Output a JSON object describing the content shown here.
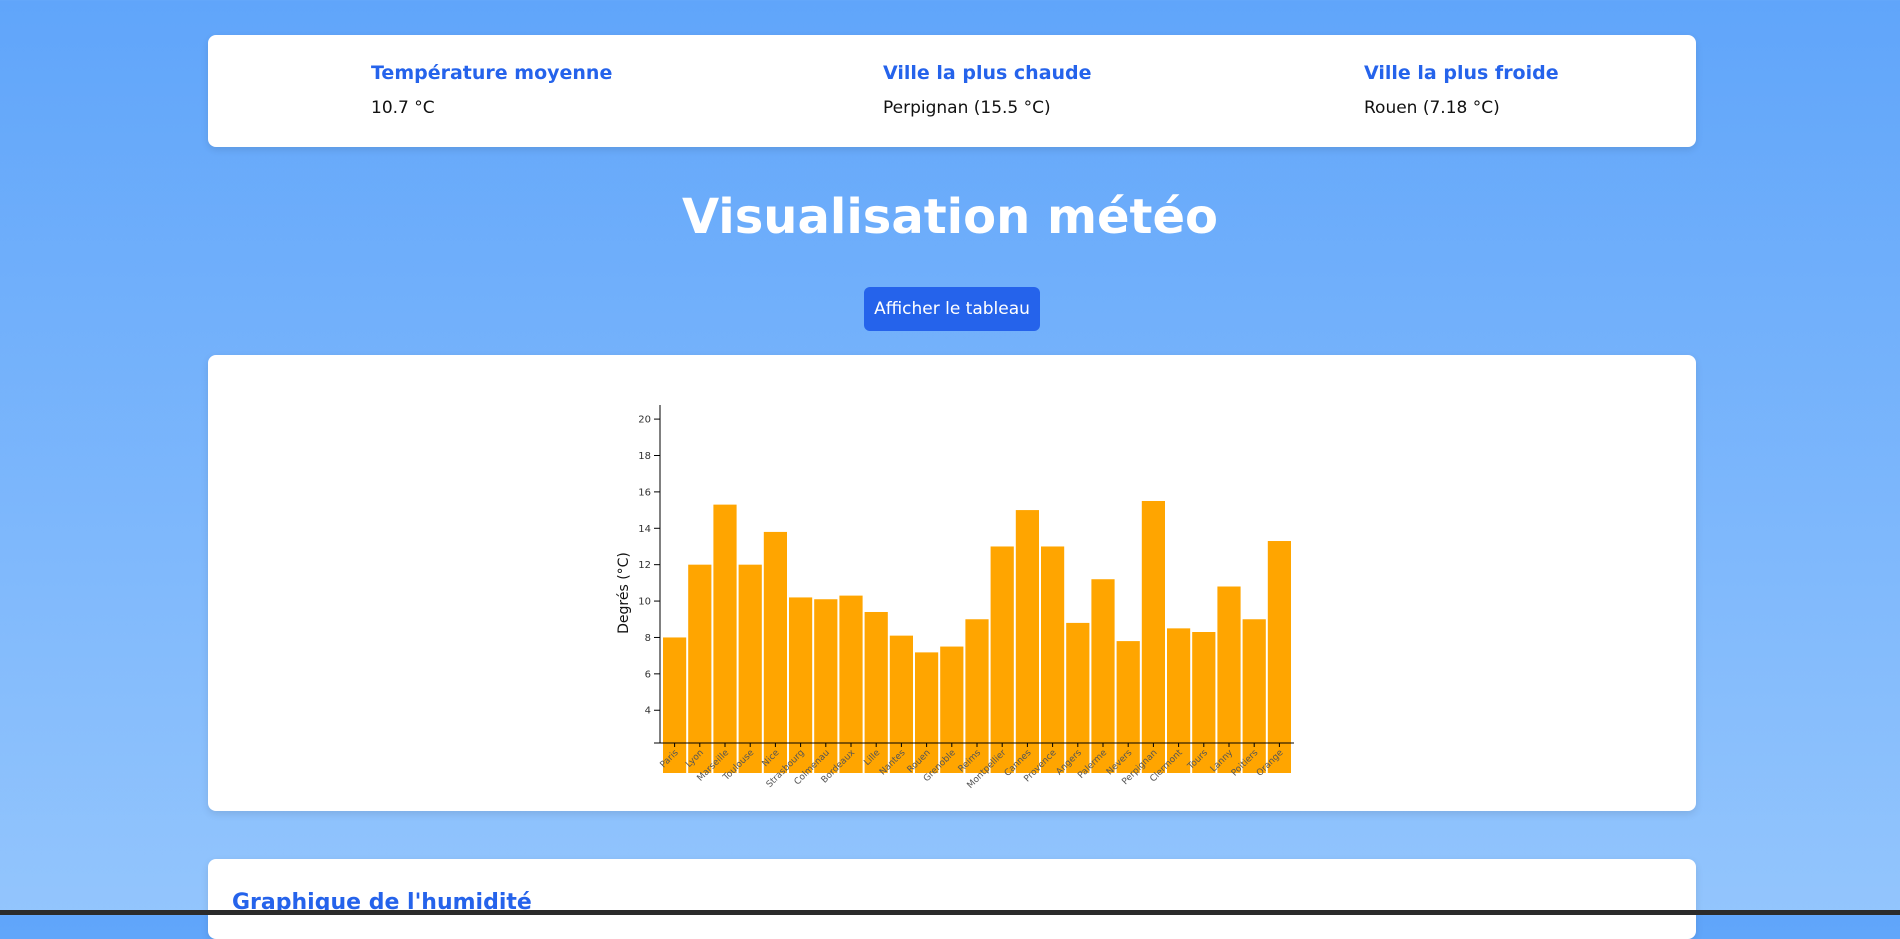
{
  "stats": [
    {
      "label": "Température moyenne",
      "value": "10.7 °C"
    },
    {
      "label": "Ville la plus chaude",
      "value": "Perpignan (15.5 °C)"
    },
    {
      "label": "Ville la plus froide",
      "value": "Rouen (7.18 °C)"
    }
  ],
  "page_title": "Visualisation météo",
  "toggle_button_label": "Afficher le tableau",
  "humidity_title": "Graphique de l'humidité",
  "colors": {
    "accent": "#2563eb",
    "bar": "#ffa500",
    "background_top": "#60a5fa",
    "background_bottom": "#93c5fd"
  },
  "chart_data": {
    "type": "bar",
    "ylabel": "Degrés (°C)",
    "xlabel": "",
    "ylim": [
      2.2,
      20.5
    ],
    "yticks": [
      4,
      6,
      8,
      10,
      12,
      14,
      16,
      18,
      20
    ],
    "categories": [
      "Paris",
      "Lyon",
      "Marseille",
      "Toulouse",
      "Nice",
      "Strasbourg",
      "Colmenau",
      "Bordeaux",
      "Lille",
      "Nantes",
      "Rouen",
      "Grenoble",
      "Reims",
      "Montpellier",
      "Cannes",
      "Provence",
      "Angers",
      "Palerme",
      "Nevers",
      "Perpignan",
      "Clermont",
      "Tours",
      "Lanny",
      "Poitiers",
      "Orange"
    ],
    "values": [
      8.0,
      12.0,
      15.3,
      12.0,
      13.8,
      10.2,
      10.1,
      10.3,
      9.4,
      8.1,
      7.18,
      7.5,
      9.0,
      13.0,
      15.0,
      13.0,
      8.8,
      11.2,
      7.8,
      15.5,
      8.5,
      8.3,
      10.8,
      9.0,
      13.3
    ]
  }
}
